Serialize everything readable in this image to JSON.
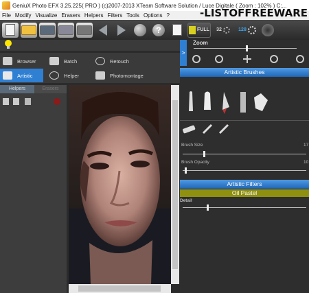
{
  "window": {
    "title": "GeniuX Photo EFX 3.25.225( PRO ) (c)2007-2013 XTeam Software Solution / Luce Digitale ( Zoom : 102% ) C:...",
    "watermark": "-LISTOFFREEWARE"
  },
  "menu": [
    "File",
    "Modify",
    "Visualize",
    "Erasers",
    "Helpers",
    "Filters",
    "Tools",
    "Options",
    "?"
  ],
  "toolbar": {
    "full_label": "FULL",
    "bits32_label": "32",
    "bits128_label": "128"
  },
  "nav": {
    "browser": "Browser",
    "batch": "Batch",
    "retouch": "Retouch",
    "artistic": "Artistic",
    "helper": "Helper",
    "photomontage": "Photomontage"
  },
  "left_tabs": {
    "helpers": "Helpers",
    "erasers": "Erasers"
  },
  "zoom": {
    "label": "Zoom",
    "level": 0.51
  },
  "artistic_brushes": {
    "title": "Artistic Brushes",
    "brush_size_label": "Brush Size",
    "brush_size_value": "17",
    "brush_size_level": 0.17,
    "brush_opacity_label": "Brush Opacity",
    "brush_opacity_value": "10",
    "brush_opacity_level": 0.02
  },
  "artistic_filters": {
    "title": "Artistic Filters",
    "current": "Oil Pastel",
    "detail_label": "Detail",
    "detail_level": 0.2
  },
  "colors": {
    "accent_blue": "#2f7fd3",
    "oil_bar": "#8f8f10",
    "panel": "#2e2e2e"
  },
  "icons": [
    "bulb-icon",
    "new-icon",
    "open-icon",
    "save-icon",
    "tools-icon",
    "back-icon",
    "forward-icon",
    "sphere-icon",
    "help-icon",
    "doc-icon",
    "zoom-in-icon",
    "zoom-out-icon",
    "move-icon"
  ]
}
